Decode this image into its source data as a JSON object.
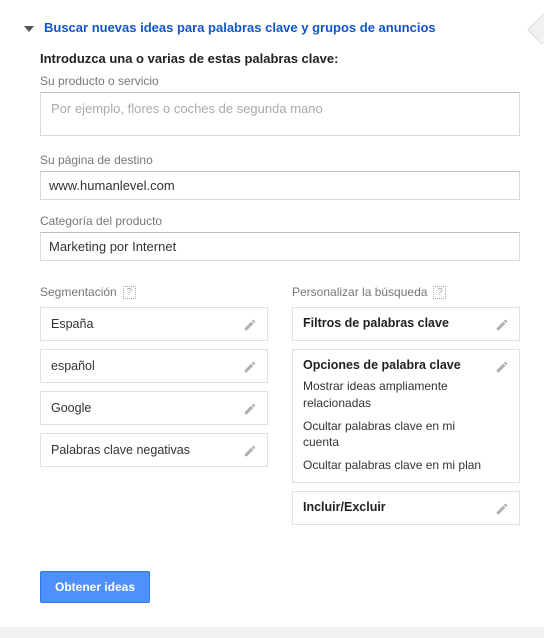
{
  "accordion": {
    "title": "Buscar nuevas ideas para palabras clave y grupos de anuncios"
  },
  "heading": "Introduzca una o varias de estas palabras clave:",
  "fields": {
    "product": {
      "label": "Su producto o servicio",
      "placeholder": "Por ejemplo, flores o coches de segunda mano",
      "value": ""
    },
    "landing": {
      "label": "Su página de destino",
      "value": "www.humanlevel.com"
    },
    "category": {
      "label": "Categoría del producto",
      "value": "Marketing por Internet"
    }
  },
  "targeting": {
    "title": "Segmentación",
    "items": [
      "España",
      "español",
      "Google",
      "Palabras clave negativas"
    ]
  },
  "customize": {
    "title": "Personalizar la búsqueda",
    "boxes": [
      {
        "title": "Filtros de palabras clave",
        "subs": []
      },
      {
        "title": "Opciones de palabra clave",
        "subs": [
          "Mostrar ideas ampliamente relacionadas",
          "Ocultar palabras clave en mi cuenta",
          "Ocultar palabras clave en mi plan"
        ]
      },
      {
        "title": "Incluir/Excluir",
        "subs": []
      }
    ]
  },
  "button": {
    "label": "Obtener ideas"
  }
}
